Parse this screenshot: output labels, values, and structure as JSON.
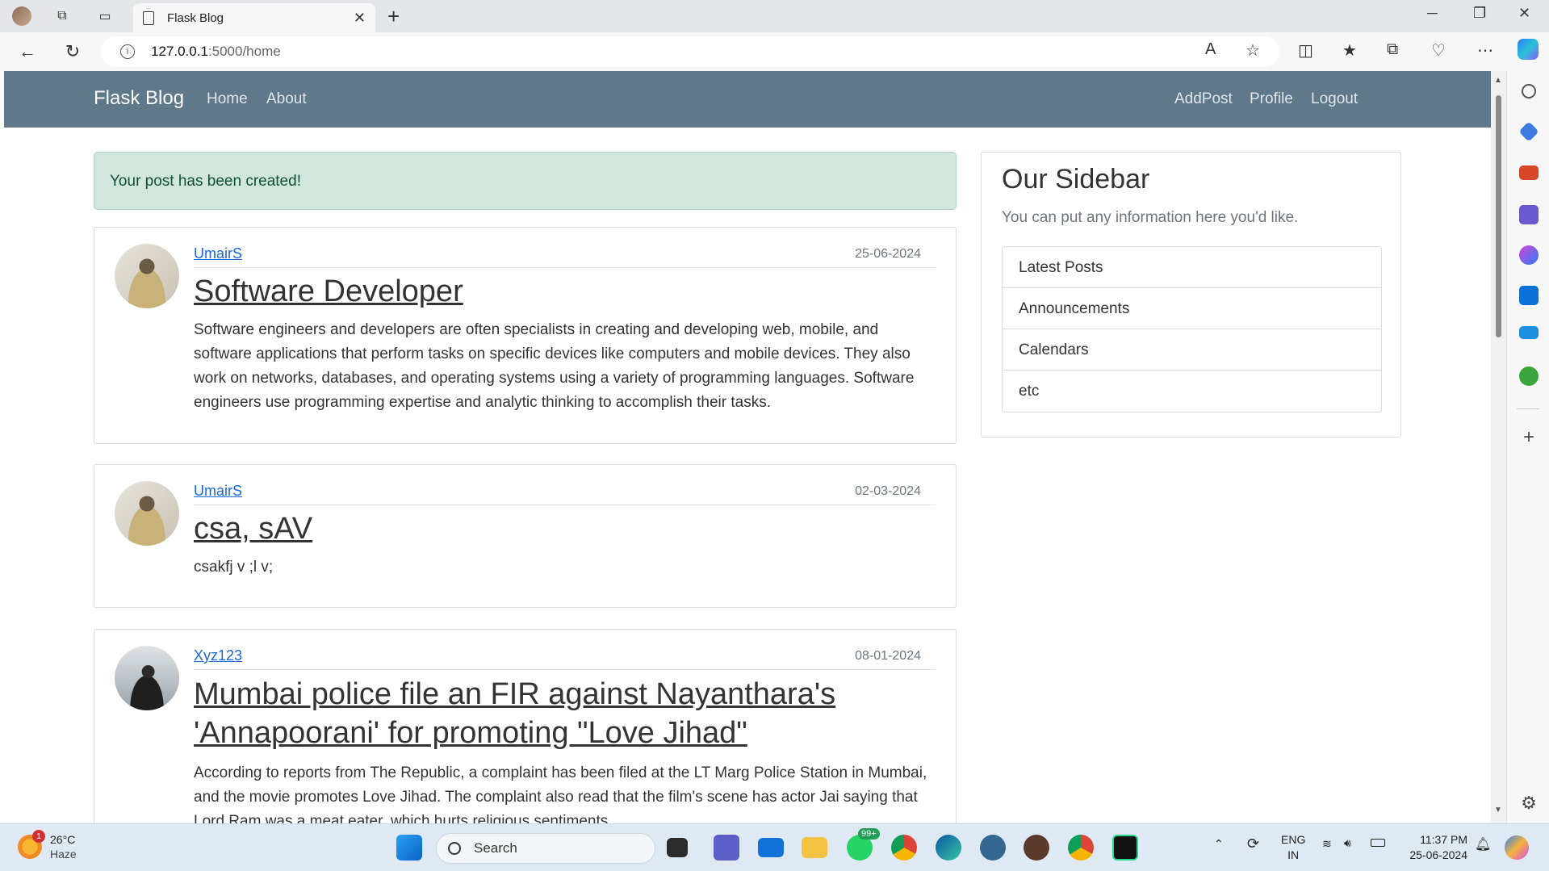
{
  "browser": {
    "tab_title": "Flask Blog",
    "url_host": "127.0.0.1",
    "url_path": ":5000/home"
  },
  "site": {
    "brand": "Flask Blog",
    "nav_left": [
      "Home",
      "About"
    ],
    "nav_right": [
      "AddPost",
      "Profile",
      "Logout"
    ]
  },
  "alert": "Your post has been created!",
  "posts": [
    {
      "author": "UmairS",
      "date": "25-06-2024",
      "title": "Software Developer",
      "body": "Software engineers and developers are often specialists in creating and developing web, mobile, and software applications that perform tasks on specific devices like computers and mobile devices. They also work on networks, databases, and operating systems using a variety of programming languages. Software engineers use programming expertise and analytic thinking to accomplish their tasks."
    },
    {
      "author": "UmairS",
      "date": "02-03-2024",
      "title": "csa, sAV",
      "body": "csakfj v ;l v;"
    },
    {
      "author": "Xyz123",
      "date": "08-01-2024",
      "title": "Mumbai police file an FIR against Nayanthara's 'Annapoorani' for promoting \"Love Jihad\"",
      "body": "According to reports from The Republic, a complaint has been filed at the LT Marg Police Station in Mumbai, and the movie promotes Love Jihad. The complaint also read that the film's scene has actor Jai saying that Lord Ram was a meat eater, which hurts religious sentiments."
    }
  ],
  "sidebar": {
    "title": "Our Sidebar",
    "subtitle": "You can put any information here you'd like.",
    "items": [
      "Latest Posts",
      "Announcements",
      "Calendars",
      "etc"
    ]
  },
  "taskbar": {
    "weather_temp": "26°C",
    "weather_desc": "Haze",
    "weather_badge": "1",
    "search_label": "Search",
    "whatsapp_badge": "99+",
    "lang_1": "ENG",
    "lang_2": "IN",
    "time": "11:37 PM",
    "date": "25-06-2024"
  },
  "colors": {
    "navbar": "#5f788a",
    "alert_bg": "#d1e7dd",
    "link": "#1a66d6"
  }
}
